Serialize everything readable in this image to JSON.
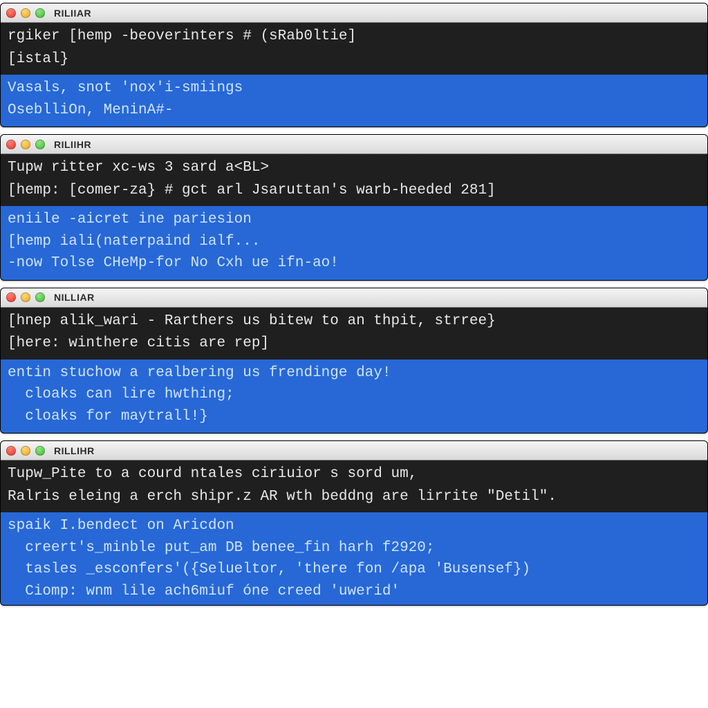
{
  "windows": [
    {
      "title": "RILIIAR",
      "cmd": "rgiker [hemp -beoverinters # (sRab0ltie]\n[istal}",
      "out": "Vasals, snot 'nox'i-smiings\nOseblliOn, MeninA#-"
    },
    {
      "title": "RILIIHR",
      "cmd": "Tupw ritter xc-ws 3 sard a<BL>\n[hemp: [comer-za} # gct arl Jsaruttan's warb-heeded 281]",
      "out": "eniile -aicret ine pariesion\n[hemp iali(naterpaind ialf...\n-now Tolse CHeMp-for No Cxh ue ifn-ao!"
    },
    {
      "title": "NILLIAR",
      "cmd": "[hnep alik_wari - Rarthers us bitew to an thpit, strree}\n[here: winthere citis are rep]",
      "out": "entin stuchow a realbering us frendinge day!\n  cloaks can lire hwthing;\n  cloaks for maytrall!}"
    },
    {
      "title": "RILLIHR",
      "cmd": "Tupw_Pite to a courd ntales ciriuior s sord um,\nRalris eleing a erch shipr.z AR wth beddng are lirrite \"Detil\".",
      "out": "spaik I.bendect on Aricdon\n  creert's_minble put_am DB benee_fin harh f2920;\n  tasles _esconfers'({Selueltor, 'there fon /apa 'Busensef})\n  Ciomp: wnm lile ach6miuf óne creed 'uwerid'"
    }
  ]
}
